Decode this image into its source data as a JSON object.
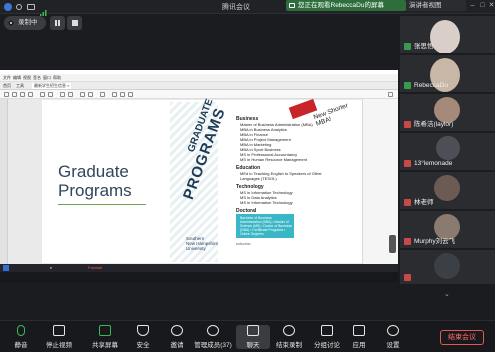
{
  "window": {
    "title": "腾讯会议",
    "share_notice": "您正在观看RebeccaDu的屏幕",
    "speaker_view": "演讲者视图",
    "record_label": "录制中"
  },
  "shared_screen": {
    "window_title": "",
    "menu": [
      "文件",
      "编辑",
      "视图",
      "签名",
      "窗口",
      "帮助"
    ],
    "tabs": [
      "首页",
      "工具",
      "最新学生招生信息 ×"
    ],
    "doc": {
      "left_title": "Graduate\nPrograms",
      "cover_grad": "GRADUATE",
      "cover_prog": "PROGRAMS",
      "logo": "Southern\nNew Hampshire\nUniversity",
      "badge": "New Shorter\nMBA!",
      "sections": [
        {
          "h": "Business",
          "items": [
            "Master of Business Administration (MBA)",
            "MBA in Business Analytics",
            "MBA in Finance",
            "MBA in Project Management",
            "MBA in Marketing",
            "MBA in Sport Business",
            "MS in Professional Accountancy",
            "MS in Human Resource Management"
          ]
        },
        {
          "h": "Education",
          "items": [
            "MEd in Teaching English to Speakers of Other Languages (TESOL)"
          ]
        },
        {
          "h": "Technology",
          "items": [
            "MS in Information Technology",
            "MS in Data Analytics",
            "MS in Information Technology"
          ]
        },
        {
          "h": "Doctoral",
          "items": [
            "International Business"
          ]
        }
      ],
      "teal_box": "Bachelor of Business Administration (BBA) • Master of Science (MS) • Doctor of Business (DBA) • Certificate Programs • Online Degrees",
      "footer": "snhu.edu"
    },
    "taskbar": [
      "e",
      "Foxmail",
      "",
      "",
      "",
      "",
      "",
      "",
      "",
      "",
      ""
    ]
  },
  "participants": [
    {
      "name": "张思悟",
      "mic": "on",
      "color": "#d9cfc8"
    },
    {
      "name": "RebeccaDu",
      "mic": "on",
      "color": "#c8b6a6"
    },
    {
      "name": "陈希洁(laylor)",
      "mic": "off",
      "color": "#a58a7a"
    },
    {
      "name": "13°lemonade",
      "mic": "off",
      "color": "#4c4f55"
    },
    {
      "name": "林老师",
      "mic": "off",
      "color": "#6b5b52"
    },
    {
      "name": "Murphy刘云飞",
      "mic": "off",
      "color": "#8a7a6f"
    },
    {
      "name": "",
      "mic": "off",
      "color": "#3b3f46"
    }
  ],
  "toolbar": [
    {
      "label": "静音",
      "icon": "microphone-icon"
    },
    {
      "label": "停止视频",
      "icon": "camera-icon"
    },
    {
      "label": "共享屏幕",
      "icon": "share-screen-icon"
    },
    {
      "label": "安全",
      "icon": "shield-icon"
    },
    {
      "label": "邀请",
      "icon": "invite-icon"
    },
    {
      "label": "管理成员(37)",
      "icon": "members-icon"
    },
    {
      "label": "聊天",
      "icon": "chat-icon"
    },
    {
      "label": "结束录制",
      "icon": "stop-record-icon"
    },
    {
      "label": "分组讨论",
      "icon": "breakout-icon"
    },
    {
      "label": "应用",
      "icon": "apps-icon"
    },
    {
      "label": "设置",
      "icon": "gear-icon"
    }
  ],
  "end_label": "结束会议"
}
